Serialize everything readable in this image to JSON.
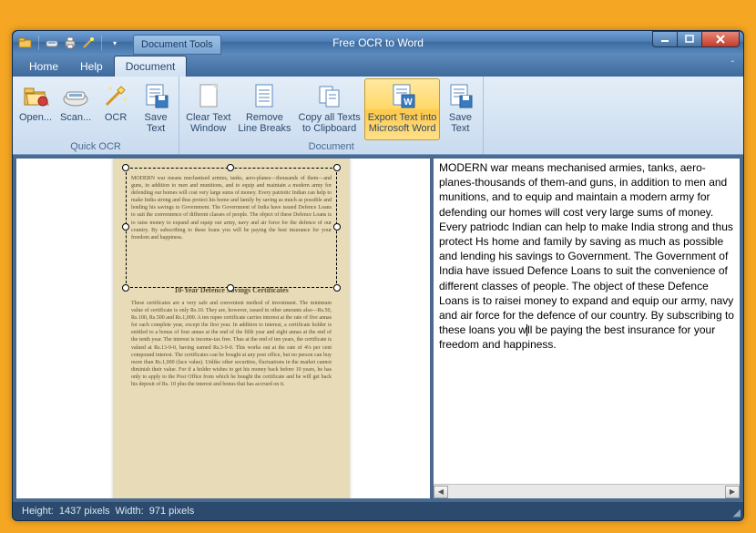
{
  "title": "Free OCR to Word",
  "context_tab": "Document Tools",
  "tabs": {
    "home": "Home",
    "help": "Help",
    "document": "Document"
  },
  "ribbon": {
    "quick_ocr": {
      "label": "Quick OCR",
      "open": "Open...",
      "scan": "Scan...",
      "ocr": "OCR",
      "save_text": "Save\nText"
    },
    "document": {
      "label": "Document",
      "clear_text": "Clear Text\nWindow",
      "remove_breaks": "Remove\nLine Breaks",
      "copy_clipboard": "Copy all Texts\nto Clipboard",
      "export_word": "Export Text into\nMicrosoft Word",
      "save_text2": "Save\nText"
    }
  },
  "scanned": {
    "para1": "MODERN war means mechanised armies, tanks, aero-planes—thousands of them—and guns, in addition to men and munitions, and to equip and maintain a modern army for defending our homes will cost very large sums of money. Every patriotic Indian can help to make India strong and thus protect his home and family by saving as much as possible and lending his savings to Government. The Government of India have issued Defence Loans to suit the convenience of different classes of people. The object of these Defence Loans is to raise money to expand and equip our army, navy and air force for the defence of our country. By subscribing to these loans you will be paying the best insurance for your freedom and happiness.",
    "heading": "10-Year Defence Savings Certificates",
    "para2": "These certificates are a very safe and convenient method of investment. The minimum value of certificate is only Rs.10. They are, however, issued in other amounts also—Rs.50, Rs.100, Rs.500 and Rs.1,000. A ten rupee certificate carries interest at the rate of five annas for each complete year, except the first year. In addition to interest, a certificate holder is entitled to a bonus of four annas at the end of the fifth year and eight annas at the end of the tenth year. The interest is income-tax free. Thus at the end of ten years, the certificate is valued at Rs.13-9-0, having earned Rs.3-9-0. This works out at the rate of 4⅛ per cent compound interest. The certificates can be bought at any post office, but no person can buy more than Rs.1,000 (face value). Unlike other securities, fluctuations in the market cannot diminish their value. For if a holder wishes to get his money back before 10 years, he has only to apply to the Post Office from which he bought the certificate and he will get back his deposit of Rs. 10 plus the interest and bonus that has accrued on it."
  },
  "ocr_output": {
    "pre": "MODERN war means mechanised armies, tanks, aero-planes-thousands of them-and guns, in addition to men and munitions, and to equip and maintain a modern army for defending our homes will cost very large sums of money. Every patriodc Indian can help to make India strong and thus protect Hs home and family by saving as much as possible and lending his savings to Government. The Government of India have issued Defence Loans to suit the convenience of different classes of people. The object of these Defence Loans is to raisei money to expand and equip our army, navy and air force for the defence of our country. By subscribing to these loans you w",
    "post": "ll be paying the best insurance for your freedom and happiness."
  },
  "status": {
    "height_label": "Height:",
    "height_value": "1437 pixels",
    "width_label": "Width:",
    "width_value": "971 pixels"
  }
}
